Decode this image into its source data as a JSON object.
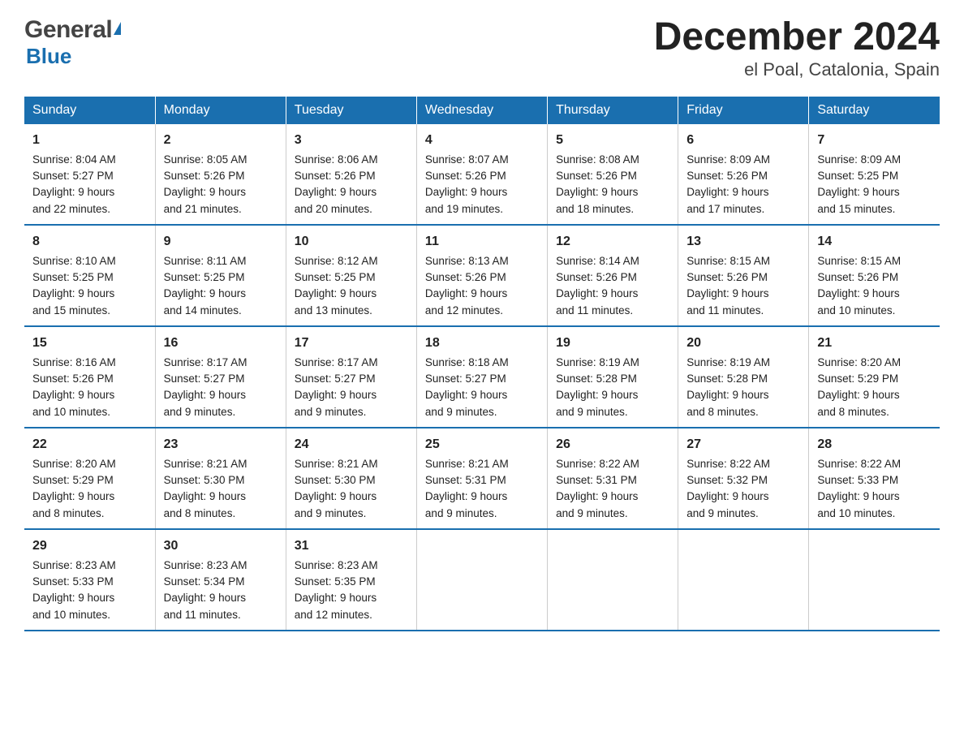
{
  "header": {
    "logo_general": "General",
    "logo_blue": "Blue",
    "title": "December 2024",
    "subtitle": "el Poal, Catalonia, Spain"
  },
  "calendar": {
    "days_of_week": [
      "Sunday",
      "Monday",
      "Tuesday",
      "Wednesday",
      "Thursday",
      "Friday",
      "Saturday"
    ],
    "weeks": [
      [
        {
          "day": "1",
          "sunrise": "8:04 AM",
          "sunset": "5:27 PM",
          "daylight": "9 hours and 22 minutes."
        },
        {
          "day": "2",
          "sunrise": "8:05 AM",
          "sunset": "5:26 PM",
          "daylight": "9 hours and 21 minutes."
        },
        {
          "day": "3",
          "sunrise": "8:06 AM",
          "sunset": "5:26 PM",
          "daylight": "9 hours and 20 minutes."
        },
        {
          "day": "4",
          "sunrise": "8:07 AM",
          "sunset": "5:26 PM",
          "daylight": "9 hours and 19 minutes."
        },
        {
          "day": "5",
          "sunrise": "8:08 AM",
          "sunset": "5:26 PM",
          "daylight": "9 hours and 18 minutes."
        },
        {
          "day": "6",
          "sunrise": "8:09 AM",
          "sunset": "5:26 PM",
          "daylight": "9 hours and 17 minutes."
        },
        {
          "day": "7",
          "sunrise": "8:09 AM",
          "sunset": "5:25 PM",
          "daylight": "9 hours and 15 minutes."
        }
      ],
      [
        {
          "day": "8",
          "sunrise": "8:10 AM",
          "sunset": "5:25 PM",
          "daylight": "9 hours and 15 minutes."
        },
        {
          "day": "9",
          "sunrise": "8:11 AM",
          "sunset": "5:25 PM",
          "daylight": "9 hours and 14 minutes."
        },
        {
          "day": "10",
          "sunrise": "8:12 AM",
          "sunset": "5:25 PM",
          "daylight": "9 hours and 13 minutes."
        },
        {
          "day": "11",
          "sunrise": "8:13 AM",
          "sunset": "5:26 PM",
          "daylight": "9 hours and 12 minutes."
        },
        {
          "day": "12",
          "sunrise": "8:14 AM",
          "sunset": "5:26 PM",
          "daylight": "9 hours and 11 minutes."
        },
        {
          "day": "13",
          "sunrise": "8:15 AM",
          "sunset": "5:26 PM",
          "daylight": "9 hours and 11 minutes."
        },
        {
          "day": "14",
          "sunrise": "8:15 AM",
          "sunset": "5:26 PM",
          "daylight": "9 hours and 10 minutes."
        }
      ],
      [
        {
          "day": "15",
          "sunrise": "8:16 AM",
          "sunset": "5:26 PM",
          "daylight": "9 hours and 10 minutes."
        },
        {
          "day": "16",
          "sunrise": "8:17 AM",
          "sunset": "5:27 PM",
          "daylight": "9 hours and 9 minutes."
        },
        {
          "day": "17",
          "sunrise": "8:17 AM",
          "sunset": "5:27 PM",
          "daylight": "9 hours and 9 minutes."
        },
        {
          "day": "18",
          "sunrise": "8:18 AM",
          "sunset": "5:27 PM",
          "daylight": "9 hours and 9 minutes."
        },
        {
          "day": "19",
          "sunrise": "8:19 AM",
          "sunset": "5:28 PM",
          "daylight": "9 hours and 9 minutes."
        },
        {
          "day": "20",
          "sunrise": "8:19 AM",
          "sunset": "5:28 PM",
          "daylight": "9 hours and 8 minutes."
        },
        {
          "day": "21",
          "sunrise": "8:20 AM",
          "sunset": "5:29 PM",
          "daylight": "9 hours and 8 minutes."
        }
      ],
      [
        {
          "day": "22",
          "sunrise": "8:20 AM",
          "sunset": "5:29 PM",
          "daylight": "9 hours and 8 minutes."
        },
        {
          "day": "23",
          "sunrise": "8:21 AM",
          "sunset": "5:30 PM",
          "daylight": "9 hours and 8 minutes."
        },
        {
          "day": "24",
          "sunrise": "8:21 AM",
          "sunset": "5:30 PM",
          "daylight": "9 hours and 9 minutes."
        },
        {
          "day": "25",
          "sunrise": "8:21 AM",
          "sunset": "5:31 PM",
          "daylight": "9 hours and 9 minutes."
        },
        {
          "day": "26",
          "sunrise": "8:22 AM",
          "sunset": "5:31 PM",
          "daylight": "9 hours and 9 minutes."
        },
        {
          "day": "27",
          "sunrise": "8:22 AM",
          "sunset": "5:32 PM",
          "daylight": "9 hours and 9 minutes."
        },
        {
          "day": "28",
          "sunrise": "8:22 AM",
          "sunset": "5:33 PM",
          "daylight": "9 hours and 10 minutes."
        }
      ],
      [
        {
          "day": "29",
          "sunrise": "8:23 AM",
          "sunset": "5:33 PM",
          "daylight": "9 hours and 10 minutes."
        },
        {
          "day": "30",
          "sunrise": "8:23 AM",
          "sunset": "5:34 PM",
          "daylight": "9 hours and 11 minutes."
        },
        {
          "day": "31",
          "sunrise": "8:23 AM",
          "sunset": "5:35 PM",
          "daylight": "9 hours and 12 minutes."
        },
        null,
        null,
        null,
        null
      ]
    ],
    "labels": {
      "sunrise": "Sunrise:",
      "sunset": "Sunset:",
      "daylight": "Daylight:"
    }
  }
}
